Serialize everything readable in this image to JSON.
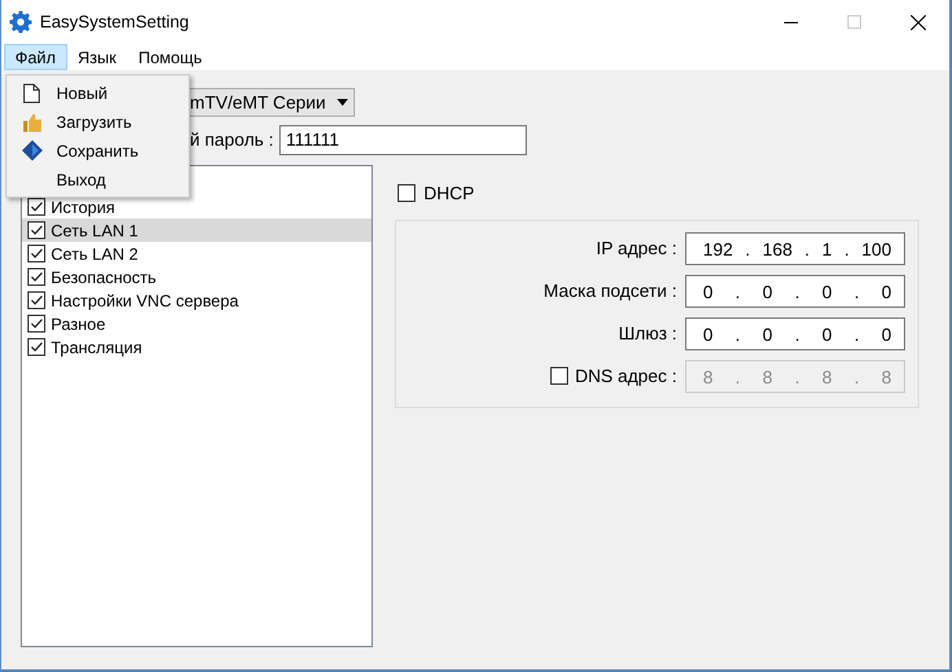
{
  "window": {
    "title": "EasySystemSetting"
  },
  "menu": [
    {
      "label": "Файл",
      "selected": true
    },
    {
      "label": "Язык",
      "selected": false
    },
    {
      "label": "Помощь",
      "selected": false
    }
  ],
  "dropdown": [
    {
      "label": "Новый",
      "kind": "new"
    },
    {
      "label": "Загрузить",
      "kind": "load"
    },
    {
      "label": "Сохранить",
      "kind": "save"
    },
    {
      "label": "Выход",
      "kind": "none"
    }
  ],
  "series_combo": {
    "value": "mTV/eMT Серии"
  },
  "password": {
    "label": "й пароль :",
    "value": "111111"
  },
  "sections": [
    {
      "label": "История",
      "checked": true,
      "selected": false
    },
    {
      "label": "Сеть LAN 1",
      "checked": true,
      "selected": true
    },
    {
      "label": "Сеть LAN 2",
      "checked": true,
      "selected": false
    },
    {
      "label": "Безопасность",
      "checked": true,
      "selected": false
    },
    {
      "label": "Настройки VNC сервера",
      "checked": true,
      "selected": false
    },
    {
      "label": "Разное",
      "checked": true,
      "selected": false
    },
    {
      "label": "Трансляция",
      "checked": true,
      "selected": false
    }
  ],
  "dhcp": {
    "label": "DHCP",
    "checked": false
  },
  "network": [
    {
      "label": "IP адрес :",
      "kind": "plain",
      "value": "192 . 168 . 1 . 100",
      "disabled": false
    },
    {
      "label": "Маска подсети :",
      "kind": "plain",
      "value": "0 . 0 . 0 . 0",
      "disabled": false
    },
    {
      "label": "Шлюз :",
      "kind": "plain",
      "value": "0 . 0 . 0 . 0",
      "disabled": false
    },
    {
      "label": "DNS адрес :",
      "kind": "checkbox",
      "checked": false,
      "value": "8 . 8 . 8 . 8",
      "disabled": true
    }
  ]
}
